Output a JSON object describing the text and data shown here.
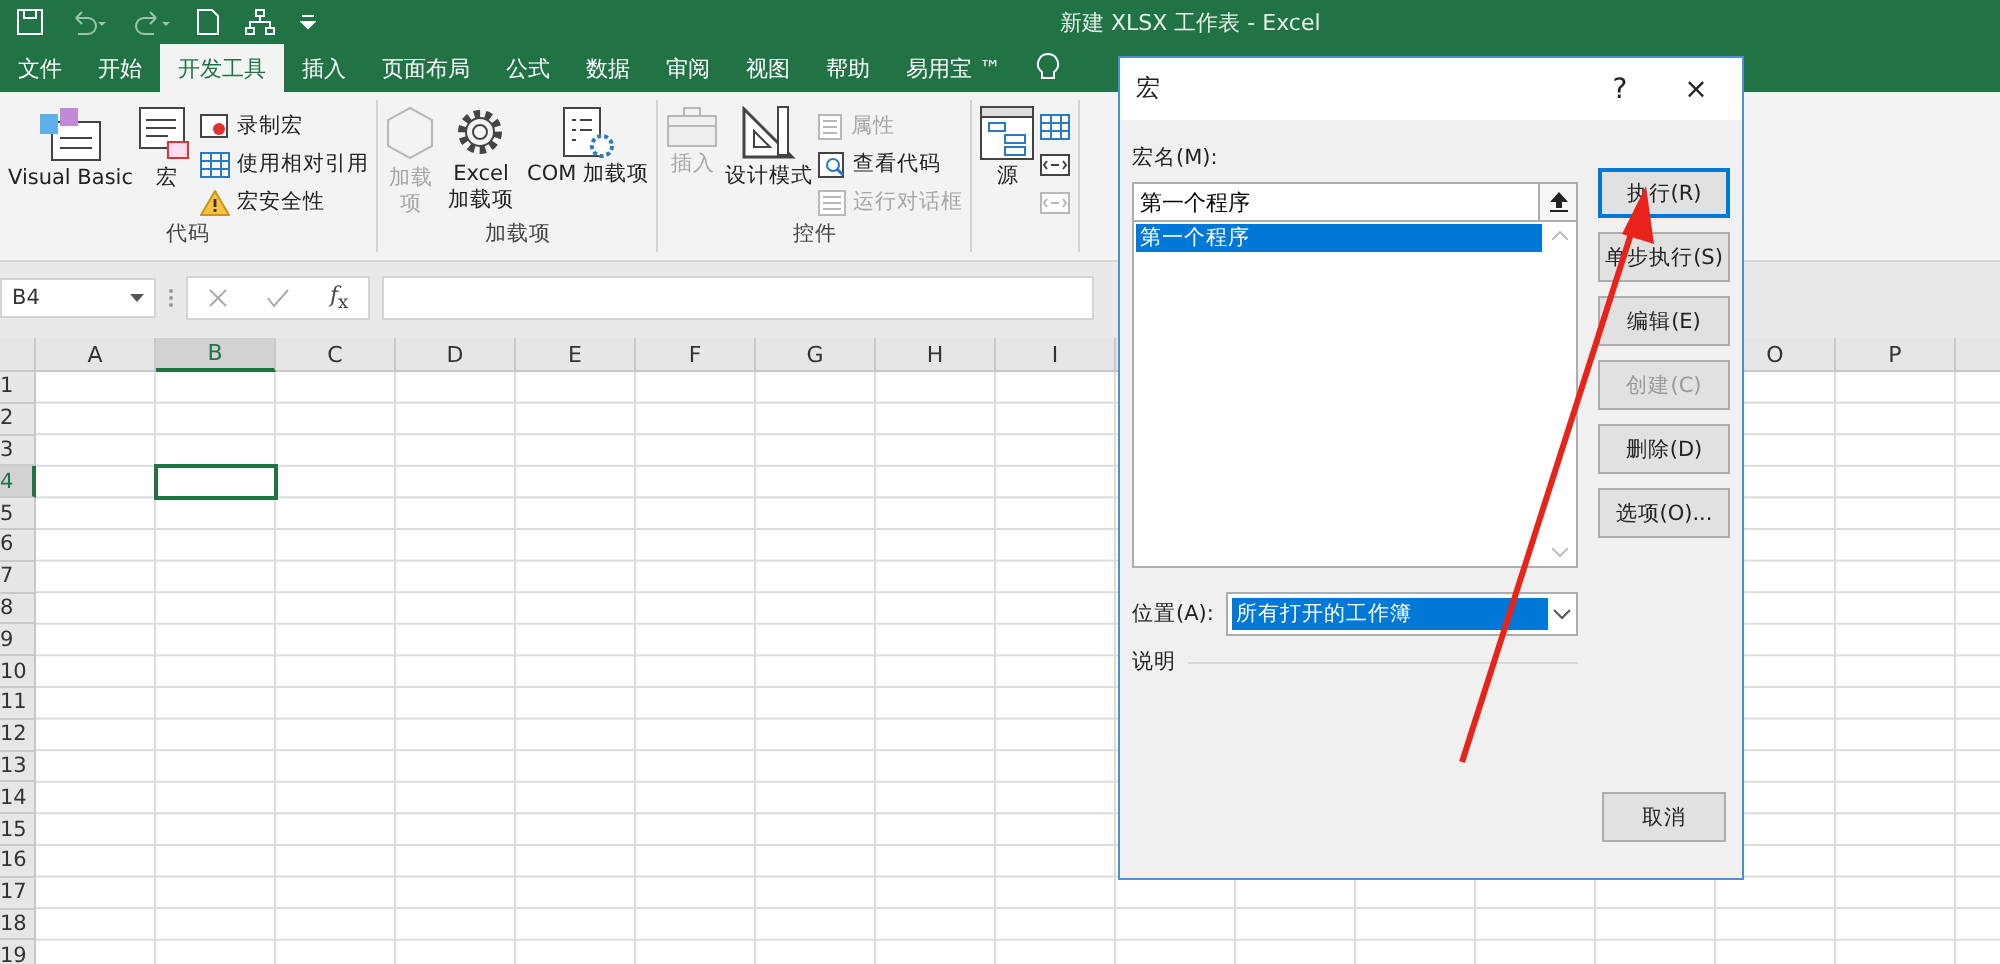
{
  "window": {
    "title": "新建 XLSX 工作表  -  Excel"
  },
  "tabs": [
    {
      "label": "文件",
      "selected": false
    },
    {
      "label": "开始",
      "selected": false
    },
    {
      "label": "开发工具",
      "selected": true
    },
    {
      "label": "插入",
      "selected": false
    },
    {
      "label": "页面布局",
      "selected": false
    },
    {
      "label": "公式",
      "selected": false
    },
    {
      "label": "数据",
      "selected": false
    },
    {
      "label": "审阅",
      "selected": false
    },
    {
      "label": "视图",
      "selected": false
    },
    {
      "label": "帮助",
      "selected": false
    },
    {
      "label": "易用宝 ™",
      "selected": false
    }
  ],
  "ribbon": {
    "groups": [
      {
        "label": "代码",
        "items": [
          {
            "kind": "large",
            "label": "Visual Basic",
            "disabled": false
          },
          {
            "kind": "large",
            "label": "宏",
            "disabled": false
          },
          {
            "kind": "stack",
            "items": [
              {
                "label": "录制宏",
                "disabled": false
              },
              {
                "label": "使用相对引用",
                "disabled": false
              },
              {
                "label": "宏安全性",
                "disabled": false
              }
            ]
          }
        ]
      },
      {
        "label": "加载项",
        "items": [
          {
            "kind": "large",
            "label": "加载项",
            "disabled": true
          },
          {
            "kind": "large",
            "label": "Excel 加载项",
            "disabled": false
          },
          {
            "kind": "large",
            "label": "COM 加载项",
            "disabled": false
          }
        ]
      },
      {
        "label": "控件",
        "items": [
          {
            "kind": "large",
            "label": "插入",
            "disabled": true
          },
          {
            "kind": "large",
            "label": "设计模式",
            "disabled": false
          },
          {
            "kind": "stack",
            "items": [
              {
                "label": "属性",
                "disabled": true
              },
              {
                "label": "查看代码",
                "disabled": false
              },
              {
                "label": "运行对话框",
                "disabled": true
              }
            ]
          }
        ]
      },
      {
        "items": [
          {
            "kind": "large",
            "label": "源",
            "disabled": false
          },
          {
            "kind": "stack",
            "items": [
              {
                "disabled": false
              },
              {
                "disabled": false
              },
              {
                "disabled": true
              }
            ]
          }
        ]
      }
    ]
  },
  "formula_bar": {
    "name_box": "B4",
    "fx": "*f*$_{x}$"
  },
  "sheet": {
    "columns_left": [
      {
        "label": "A",
        "selected": false
      },
      {
        "label": "B",
        "selected": true
      },
      {
        "label": "C",
        "selected": false
      },
      {
        "label": "D",
        "selected": false
      },
      {
        "label": "E",
        "selected": false
      },
      {
        "label": "F",
        "selected": false
      },
      {
        "label": "G",
        "selected": false
      },
      {
        "label": "H",
        "selected": false
      },
      {
        "label": "I",
        "selected": false
      }
    ],
    "columns_right": [
      {
        "label": "O",
        "selected": false
      },
      {
        "label": "P",
        "selected": false
      }
    ],
    "rows": [
      {
        "label": "1",
        "selected": false
      },
      {
        "label": "2",
        "selected": false
      },
      {
        "label": "3",
        "selected": false
      },
      {
        "label": "4",
        "selected": true
      },
      {
        "label": "5",
        "selected": false
      },
      {
        "label": "6",
        "selected": false
      },
      {
        "label": "7",
        "selected": false
      },
      {
        "label": "8",
        "selected": false
      },
      {
        "label": "9",
        "selected": false
      },
      {
        "label": "10",
        "selected": false
      },
      {
        "label": "11",
        "selected": false
      },
      {
        "label": "12",
        "selected": false
      },
      {
        "label": "13",
        "selected": false
      },
      {
        "label": "14",
        "selected": false
      },
      {
        "label": "15",
        "selected": false
      },
      {
        "label": "16",
        "selected": false
      },
      {
        "label": "17",
        "selected": false
      },
      {
        "label": "18",
        "selected": false
      },
      {
        "label": "19",
        "selected": false
      }
    ]
  },
  "dialog": {
    "title": "宏",
    "help": "?",
    "close": "×",
    "name_label": "宏名(M):",
    "name_value": "第一个程序",
    "macros": [
      {
        "label": "第一个程序",
        "selected": true
      }
    ],
    "buttons": [
      {
        "label": "执行(R)",
        "default": true,
        "disabled": false
      },
      {
        "label": "单步执行(S)",
        "default": false,
        "disabled": false
      },
      {
        "label": "编辑(E)",
        "default": false,
        "disabled": false
      },
      {
        "label": "创建(C)",
        "default": false,
        "disabled": true
      },
      {
        "label": "删除(D)",
        "default": false,
        "disabled": false
      },
      {
        "label": "选项(O)...",
        "default": false,
        "disabled": false
      }
    ],
    "location_label": "位置(A):",
    "location_value": "所有打开的工作簿",
    "description_label": "说明",
    "cancel": "取消"
  }
}
